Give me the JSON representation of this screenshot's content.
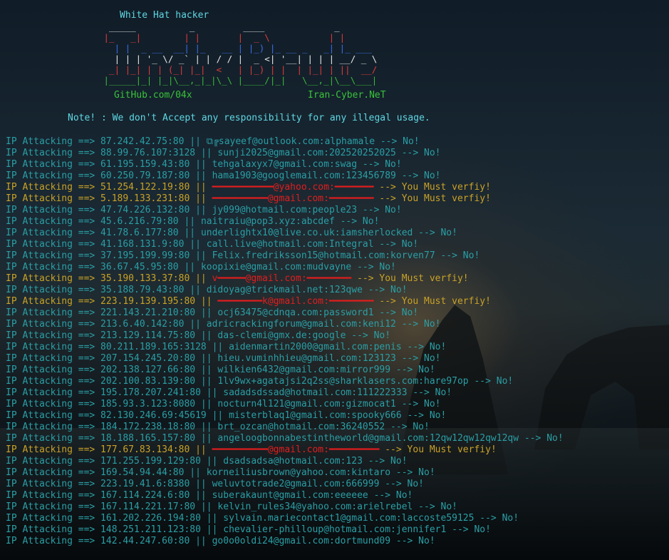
{
  "banner": {
    "title": "White Hat hacker",
    "ascii": [
      "  _____          _         ____             _",
      " |_   _|        | |       |  _ \\           | |",
      "   | |  _ __  __| |_   __ | |_) |_ __ _   _| |_ ___",
      "   | | | '_ \\/ _` | | / / |  _ <| '__| | | | __/ _ \\",
      "  _| |_| | | (_| |_|  <   | |_) | |  | |_| | ||  __/",
      " |_____|_| |_|\\__,_|_|\\_\\ |____/|_|   \\__,_|\\__\\___|"
    ],
    "github": "GitHub.com/04x",
    "site": "Iran-Cyber.NeT",
    "note": "Note! : We don't Accept any responsibility for any illegal usage."
  },
  "log": [
    {
      "prefix": "IP Attacking ==> 87.242.42.75:80 || ",
      "mid": "",
      "suffix": "⧉╔sayeef@outlook.com:alphamale --> No!",
      "status": "no"
    },
    {
      "prefix": "IP Attacking ==> 88.99.76.107:3128 || ",
      "mid": "",
      "suffix": "sunji2025@gmail.com:202520252025 --> No!",
      "status": "no"
    },
    {
      "prefix": "IP Attacking ==> 61.195.159.43:80 || ",
      "mid": "",
      "suffix": "tehgalaxyx7@gmail.com:swag --> No!",
      "status": "no"
    },
    {
      "prefix": "IP Attacking ==> 60.250.79.187:80 || ",
      "mid": "",
      "suffix": "hama1903@googlemail.com:123456789 --> No!",
      "status": "no"
    },
    {
      "prefix": "IP Attacking ==> 51.254.122.19:80 || ",
      "mid": "━━━━━━━━━━━@yahoo.com:━━━━━━━",
      "suffix": " --> You Must verfiy!",
      "status": "hit"
    },
    {
      "prefix": "IP Attacking ==> 5.189.133.231:80 || ",
      "mid": "━━━━━━━━━━@gmail.com:━━━━━━━━",
      "suffix": " --> You Must verfiy!",
      "status": "hit"
    },
    {
      "prefix": "IP Attacking ==> 47.74.226.132:80 || ",
      "mid": "",
      "suffix": "jy099@hotmail.com:people23 --> No!",
      "status": "no"
    },
    {
      "prefix": "IP Attacking ==> 45.6.216.79:80 || ",
      "mid": "",
      "suffix": "naitraiu@pop3.xyz:abcdef --> No!",
      "status": "no"
    },
    {
      "prefix": "IP Attacking ==> 41.78.6.177:80 || ",
      "mid": "",
      "suffix": "underlightx10@live.co.uk:iamsherlocked --> No!",
      "status": "no"
    },
    {
      "prefix": "IP Attacking ==> 41.168.131.9:80 || ",
      "mid": "",
      "suffix": "call.live@hotmail.com:Integral --> No!",
      "status": "no"
    },
    {
      "prefix": "IP Attacking ==> 37.195.199.99:80 || ",
      "mid": "",
      "suffix": "Felix.fredriksson15@hotmail.com:korven77 --> No!",
      "status": "no"
    },
    {
      "prefix": "IP Attacking ==> 36.67.45.95:80 || ",
      "mid": "",
      "suffix": "koopixie@gmail.com:mudvayne --> No!",
      "status": "no"
    },
    {
      "prefix": "IP Attacking ==> 35.190.133.37:80 || ",
      "mid": "v━━━━━@gmail.com:━━━━━━━━",
      "suffix": " --> You Must verfiy!",
      "status": "hit"
    },
    {
      "prefix": "IP Attacking ==> 35.188.79.43:80 || ",
      "mid": "",
      "suffix": "didoyag@trickmail.net:123qwe --> No!",
      "status": "no"
    },
    {
      "prefix": "IP Attacking ==> 223.19.139.195:80 || ",
      "mid": "━━━━━━━━k@gmail.com:━━━━━━━━",
      "suffix": " --> You Must verfiy!",
      "status": "hit"
    },
    {
      "prefix": "IP Attacking ==> 221.143.21.210:80 || ",
      "mid": "",
      "suffix": "ocj63475@cdnqa.com:password1 --> No!",
      "status": "no"
    },
    {
      "prefix": "IP Attacking ==> 213.6.40.142:80 || ",
      "mid": "",
      "suffix": "adricrackingforum@gmail.com:keni12 --> No!",
      "status": "no"
    },
    {
      "prefix": "IP Attacking ==> 213.129.114.75:80 || ",
      "mid": "",
      "suffix": "das-clemi@gmx.de:google --> No!",
      "status": "no"
    },
    {
      "prefix": "IP Attacking ==> 80.211.189.165:3128 || ",
      "mid": "",
      "suffix": "aidenmartin2000@gmail.com:penis --> No!",
      "status": "no"
    },
    {
      "prefix": "IP Attacking ==> 207.154.245.20:80 || ",
      "mid": "",
      "suffix": "hieu.vuminhhieu@gmail.com:123123 --> No!",
      "status": "no"
    },
    {
      "prefix": "IP Attacking ==> 202.138.127.66:80 || ",
      "mid": "",
      "suffix": "wilkien6432@gmail.com:mirror999 --> No!",
      "status": "no"
    },
    {
      "prefix": "IP Attacking ==> 202.100.83.139:80 || ",
      "mid": "",
      "suffix": "1lv9wx+agatajsi2q2ss@sharklasers.com:hare97op --> No!",
      "status": "no"
    },
    {
      "prefix": "IP Attacking ==> 195.178.207.241:80 || ",
      "mid": "",
      "suffix": "sadadsdssad@hotmail.com:111222333 --> No!",
      "status": "no"
    },
    {
      "prefix": "IP Attacking ==> 185.93.3.123:8080 || ",
      "mid": "",
      "suffix": "nocturn4l121@gmail.com:gizmocat1 --> No!",
      "status": "no"
    },
    {
      "prefix": "IP Attacking ==> 82.130.246.69:45619 || ",
      "mid": "",
      "suffix": "misterblaq1@gmail.com:spooky666 --> No!",
      "status": "no"
    },
    {
      "prefix": "IP Attacking ==> 184.172.238.18:80 || ",
      "mid": "",
      "suffix": "brt_ozcan@hotmail.com:36240552 --> No!",
      "status": "no"
    },
    {
      "prefix": "IP Attacking ==> 18.188.165.157:80 || ",
      "mid": "",
      "suffix": "angeloogbonnabestintheworld@gmail.com:12qw12qw12qw12qw --> No!",
      "status": "no"
    },
    {
      "prefix": "IP Attacking ==> 177.67.83.134:80 || ",
      "mid": "━━━━━━━━━━@gmail.com:━━━━━━━━━",
      "suffix": " --> You Must verfiy!",
      "status": "hit"
    },
    {
      "prefix": "IP Attacking ==> 171.255.199.129:80 || ",
      "mid": "",
      "suffix": "dsadsadsa@hotmail.com:123 --> No!",
      "status": "no"
    },
    {
      "prefix": "IP Attacking ==> 169.54.94.44:80 || ",
      "mid": "",
      "suffix": "korneiliusbrown@yahoo.com:kintaro --> No!",
      "status": "no"
    },
    {
      "prefix": "IP Attacking ==> 223.19.41.6:8380 || ",
      "mid": "",
      "suffix": "weluvtotrade2@gmail.com:666999 --> No!",
      "status": "no"
    },
    {
      "prefix": "IP Attacking ==> 167.114.224.6:80 || ",
      "mid": "",
      "suffix": "suberakaunt@gmail.com:eeeeee --> No!",
      "status": "no"
    },
    {
      "prefix": "IP Attacking ==> 167.114.221.17:80 || ",
      "mid": "",
      "suffix": "kelvin_rules34@yahoo.com:arielrebel --> No!",
      "status": "no"
    },
    {
      "prefix": "IP Attacking ==> 161.202.226.194:80 || ",
      "mid": "",
      "suffix": "sylvain.mariecontact1@gmail.com:laccoste59125 --> No!",
      "status": "no"
    },
    {
      "prefix": "IP Attacking ==> 148.251.211.123:80 || ",
      "mid": "",
      "suffix": "chevalier-philloup@hotmail.com:jennifer1 --> No!",
      "status": "no"
    },
    {
      "prefix": "IP Attacking ==> 142.44.247.60:80 || ",
      "mid": "",
      "suffix": "go0o0oldi24@gmail.com:dortmund09 --> No!",
      "status": "no"
    }
  ]
}
